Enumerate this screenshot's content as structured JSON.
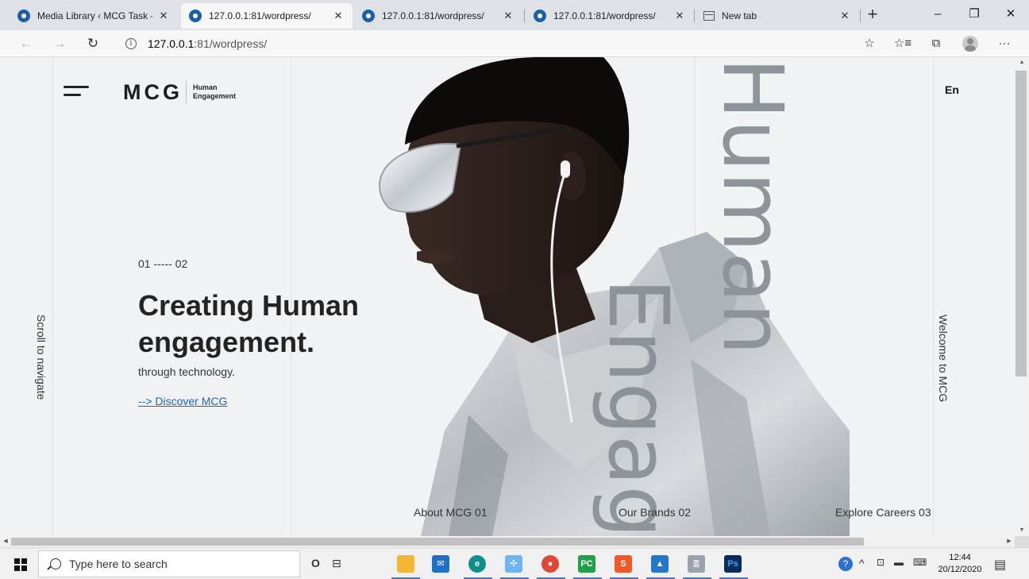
{
  "browser": {
    "tabs": [
      {
        "title": "Media Library ‹ MCG Task — W",
        "close": "✕",
        "active": false
      },
      {
        "title": "127.0.0.1:81/wordpress/",
        "close": "✕",
        "active": true
      },
      {
        "title": "127.0.0.1:81/wordpress/",
        "close": "✕",
        "active": false
      },
      {
        "title": "127.0.0.1:81/wordpress/",
        "close": "✕",
        "active": false
      },
      {
        "title": "New tab",
        "close": "✕",
        "active": false
      }
    ],
    "new_tab": "+",
    "controls": {
      "minimize": "–",
      "maximize": "❐",
      "close": "✕"
    },
    "nav": {
      "back": "←",
      "forward": "→",
      "refresh": "↻"
    },
    "address": {
      "info": "i",
      "host": "127.0.0.1",
      "rest": ":81/wordpress/"
    },
    "toolbar_icons": {
      "favorite": "☆",
      "favorites_list": "☆≡",
      "collections": "⧉",
      "more": "···"
    }
  },
  "page": {
    "logo": {
      "mark": "MCG",
      "tag_line1": "Human",
      "tag_line2": "Engagement"
    },
    "lang": "En",
    "side_left": "Scroll to navigate",
    "side_right": "Welcome to MCG",
    "big_words": {
      "human": "Human",
      "engage": "Engage"
    },
    "counter": "01 ----- 02",
    "headline_line1": "Creating Human",
    "headline_line2": "engagement.",
    "subline": "through technology.",
    "discover": "--> Discover MCG",
    "bottom_nav": [
      "About MCG 01",
      "Our Brands 02",
      "Explore Careers 03"
    ]
  },
  "taskbar": {
    "search_placeholder": "Type here to search",
    "cortana": "O",
    "task_view": "⊟",
    "apps": [
      {
        "label": "",
        "color": "#f2b632"
      },
      {
        "label": "✉",
        "color": "#1f6fc4"
      },
      {
        "label": "e",
        "color": "#0f8f8a"
      },
      {
        "label": "✣",
        "color": "#6fb5f2"
      },
      {
        "label": "●",
        "color": "#e24634"
      },
      {
        "label": "PC",
        "color": "#21a04a"
      },
      {
        "label": "S",
        "color": "#f05a2a"
      },
      {
        "label": "▲",
        "color": "#2577cc"
      },
      {
        "label": "≣",
        "color": "#9aa3ad"
      },
      {
        "label": "Ps",
        "color": "#0b2c5a"
      }
    ],
    "tray": {
      "help": "?",
      "chevron": "^",
      "time": "12:44",
      "date": "20/12/2020"
    }
  },
  "colors": {
    "accent_link": "#1a63c8",
    "page_bg": "#f1f2f4",
    "heading": "#232323"
  }
}
